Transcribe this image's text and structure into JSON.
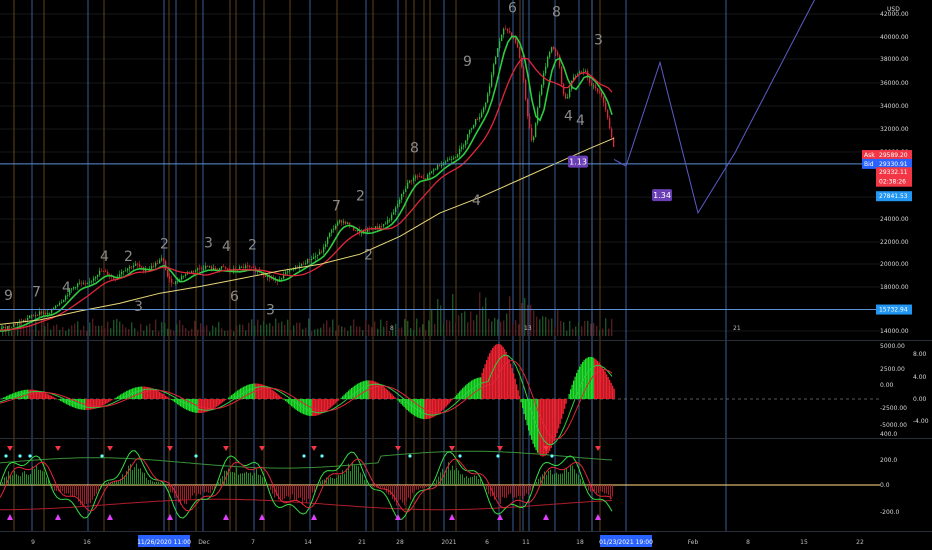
{
  "app": {
    "currency": "USD"
  },
  "chart_data": {
    "type": "candlestick",
    "main": {
      "y_ticks": [
        "42000.00",
        "40000.00",
        "38000.00",
        "36000.00",
        "34000.00",
        "32000.00",
        "30000.00",
        "26000.00",
        "24000.00",
        "22000.00",
        "20000.00",
        "18000.00",
        "14000.00"
      ],
      "ylim": [
        13000,
        43500
      ],
      "close_path": [
        [
          0,
          14000
        ],
        [
          10,
          14300
        ],
        [
          20,
          14600
        ],
        [
          30,
          15100
        ],
        [
          40,
          15500
        ],
        [
          48,
          15300
        ],
        [
          55,
          16100
        ],
        [
          62,
          16600
        ],
        [
          70,
          17500
        ],
        [
          78,
          18100
        ],
        [
          86,
          17900
        ],
        [
          94,
          18700
        ],
        [
          100,
          19200
        ],
        [
          108,
          18900
        ],
        [
          114,
          18400
        ],
        [
          120,
          19100
        ],
        [
          128,
          19500
        ],
        [
          136,
          19800
        ],
        [
          142,
          19300
        ],
        [
          150,
          19500
        ],
        [
          156,
          19900
        ],
        [
          162,
          20300
        ],
        [
          168,
          18400
        ],
        [
          174,
          18100
        ],
        [
          182,
          18800
        ],
        [
          190,
          19100
        ],
        [
          198,
          19400
        ],
        [
          206,
          19600
        ],
        [
          214,
          19300
        ],
        [
          222,
          19500
        ],
        [
          230,
          19200
        ],
        [
          238,
          19400
        ],
        [
          246,
          19600
        ],
        [
          254,
          19300
        ],
        [
          262,
          19000
        ],
        [
          268,
          18600
        ],
        [
          276,
          18300
        ],
        [
          284,
          18900
        ],
        [
          292,
          19300
        ],
        [
          300,
          19700
        ],
        [
          308,
          20200
        ],
        [
          316,
          20600
        ],
        [
          322,
          21000
        ],
        [
          328,
          22400
        ],
        [
          334,
          23200
        ],
        [
          340,
          23700
        ],
        [
          346,
          23500
        ],
        [
          352,
          23000
        ],
        [
          360,
          22600
        ],
        [
          368,
          22900
        ],
        [
          376,
          23100
        ],
        [
          384,
          23400
        ],
        [
          392,
          24200
        ],
        [
          400,
          25800
        ],
        [
          408,
          27200
        ],
        [
          416,
          27700
        ],
        [
          424,
          27400
        ],
        [
          432,
          28200
        ],
        [
          440,
          28800
        ],
        [
          448,
          29200
        ],
        [
          456,
          29600
        ],
        [
          462,
          30400
        ],
        [
          468,
          31600
        ],
        [
          474,
          32600
        ],
        [
          480,
          33200
        ],
        [
          486,
          34600
        ],
        [
          492,
          37200
        ],
        [
          498,
          39600
        ],
        [
          504,
          41000
        ],
        [
          510,
          40500
        ],
        [
          516,
          39600
        ],
        [
          522,
          37100
        ],
        [
          528,
          32300
        ],
        [
          532,
          30600
        ],
        [
          536,
          33200
        ],
        [
          540,
          35600
        ],
        [
          544,
          37200
        ],
        [
          548,
          38800
        ],
        [
          552,
          39400
        ],
        [
          558,
          38200
        ],
        [
          562,
          35200
        ],
        [
          566,
          34600
        ],
        [
          572,
          36400
        ],
        [
          578,
          37000
        ],
        [
          584,
          37200
        ],
        [
          590,
          36000
        ],
        [
          596,
          35600
        ],
        [
          602,
          34600
        ],
        [
          606,
          33500
        ],
        [
          610,
          31600
        ],
        [
          614,
          29900
        ]
      ],
      "sma_path": [
        [
          0,
          14400
        ],
        [
          40,
          14800
        ],
        [
          80,
          15600
        ],
        [
          120,
          16300
        ],
        [
          160,
          17200
        ],
        [
          200,
          17800
        ],
        [
          240,
          18500
        ],
        [
          280,
          19200
        ],
        [
          320,
          19800
        ],
        [
          360,
          20700
        ],
        [
          400,
          22300
        ],
        [
          440,
          24400
        ],
        [
          480,
          25800
        ],
        [
          520,
          27400
        ],
        [
          560,
          29000
        ],
        [
          590,
          30200
        ],
        [
          614,
          31100
        ]
      ],
      "wave_labels": [
        {
          "text": "9",
          "x": 4,
          "y": 16600
        },
        {
          "text": "7",
          "x": 32,
          "y": 16900
        },
        {
          "text": "4",
          "x": 62,
          "y": 17300
        },
        {
          "text": "4",
          "x": 100,
          "y": 20100
        },
        {
          "text": "2",
          "x": 124,
          "y": 20100
        },
        {
          "text": "2",
          "x": 160,
          "y": 21200
        },
        {
          "text": "3",
          "x": 204,
          "y": 21300
        },
        {
          "text": "4",
          "x": 222,
          "y": 21000
        },
        {
          "text": "2",
          "x": 248,
          "y": 21100
        },
        {
          "text": "3",
          "x": 134,
          "y": 15600
        },
        {
          "text": "6",
          "x": 230,
          "y": 16500
        },
        {
          "text": "3",
          "x": 266,
          "y": 15300
        },
        {
          "text": "7",
          "x": 332,
          "y": 24600
        },
        {
          "text": "2",
          "x": 356,
          "y": 25500
        },
        {
          "text": "2",
          "x": 364,
          "y": 20200
        },
        {
          "text": "8",
          "x": 410,
          "y": 29800
        },
        {
          "text": "4",
          "x": 472,
          "y": 25100
        },
        {
          "text": "9",
          "x": 463,
          "y": 37600
        },
        {
          "text": "6",
          "x": 508,
          "y": 42400
        },
        {
          "text": "8",
          "x": 552,
          "y": 42000
        },
        {
          "text": "3",
          "x": 594,
          "y": 39500
        },
        {
          "text": "4",
          "x": 564,
          "y": 32700
        },
        {
          "text": "4",
          "x": 576,
          "y": 32300
        }
      ],
      "price_tags": [
        {
          "label": "Ask",
          "value": "29589.20",
          "color": "#f23645",
          "y": 29590
        },
        {
          "label": "Bid",
          "value": "29330.91",
          "color": "#2962ff",
          "y": 28800
        },
        {
          "label": "",
          "value": "29332.11",
          "color": "#f23645",
          "y": 28050
        },
        {
          "label": "",
          "value": "02:38:26",
          "color": "#f23645",
          "y": 27200
        },
        {
          "label": "",
          "value": "27841.53",
          "color": "#2196f3",
          "y": 25900
        },
        {
          "label": "",
          "value": "15732.94",
          "color": "#2196f3",
          "y": 15733
        }
      ],
      "projection_labels": [
        {
          "text": "1.13",
          "x": 578,
          "y": 29000
        },
        {
          "text": "1.34",
          "x": 662,
          "y": 26000
        }
      ],
      "h_levels": [
        28800,
        15733
      ],
      "projection_path": [
        [
          614,
          29200
        ],
        [
          626,
          28600
        ],
        [
          660,
          37900
        ],
        [
          698,
          24400
        ],
        [
          735,
          29800
        ],
        [
          815,
          43600
        ]
      ]
    },
    "macd": {
      "y_ticks": [
        "5000.00",
        "2500.00",
        "0.00",
        "-2500.00",
        "-5000.00"
      ],
      "right_ticks": [
        "8.00",
        "4.00",
        "0.00",
        "-4.00"
      ],
      "ylim": [
        -5400,
        5400
      ]
    },
    "osc": {
      "y_ticks": [
        "400.0",
        "200.0",
        "0.0",
        "-200.0"
      ],
      "ylim": [
        -240,
        420
      ]
    },
    "x_ticks": [
      {
        "label": "9",
        "x": 33
      },
      {
        "label": "16",
        "x": 87
      },
      {
        "label": "Dec",
        "x": 204
      },
      {
        "label": "7",
        "x": 253
      },
      {
        "label": "14",
        "x": 308
      },
      {
        "label": "21",
        "x": 362
      },
      {
        "label": "28",
        "x": 400
      },
      {
        "label": "2021",
        "x": 449
      },
      {
        "label": "6",
        "x": 487
      },
      {
        "label": "11",
        "x": 526
      },
      {
        "label": "18",
        "x": 580
      },
      {
        "label": "Feb",
        "x": 693
      },
      {
        "label": "8",
        "x": 748
      },
      {
        "label": "15",
        "x": 804
      },
      {
        "label": "22",
        "x": 860
      }
    ],
    "x_highlight": [
      {
        "label": "11/26/2020 11:00",
        "x": 164
      },
      {
        "label": "01/23/2021 19:00",
        "x": 626
      }
    ],
    "bottom_marks": [
      "21",
      "13",
      "8"
    ],
    "vlines_blue": [
      32,
      88,
      164,
      176,
      203,
      254,
      310,
      366,
      398,
      444,
      499,
      513,
      523,
      529,
      555,
      579,
      592,
      626,
      726
    ],
    "vlines_orange": [
      14,
      44,
      104,
      169,
      196,
      230,
      236,
      264,
      290,
      337,
      373,
      406,
      414,
      424,
      430,
      456,
      520,
      592,
      600
    ]
  }
}
